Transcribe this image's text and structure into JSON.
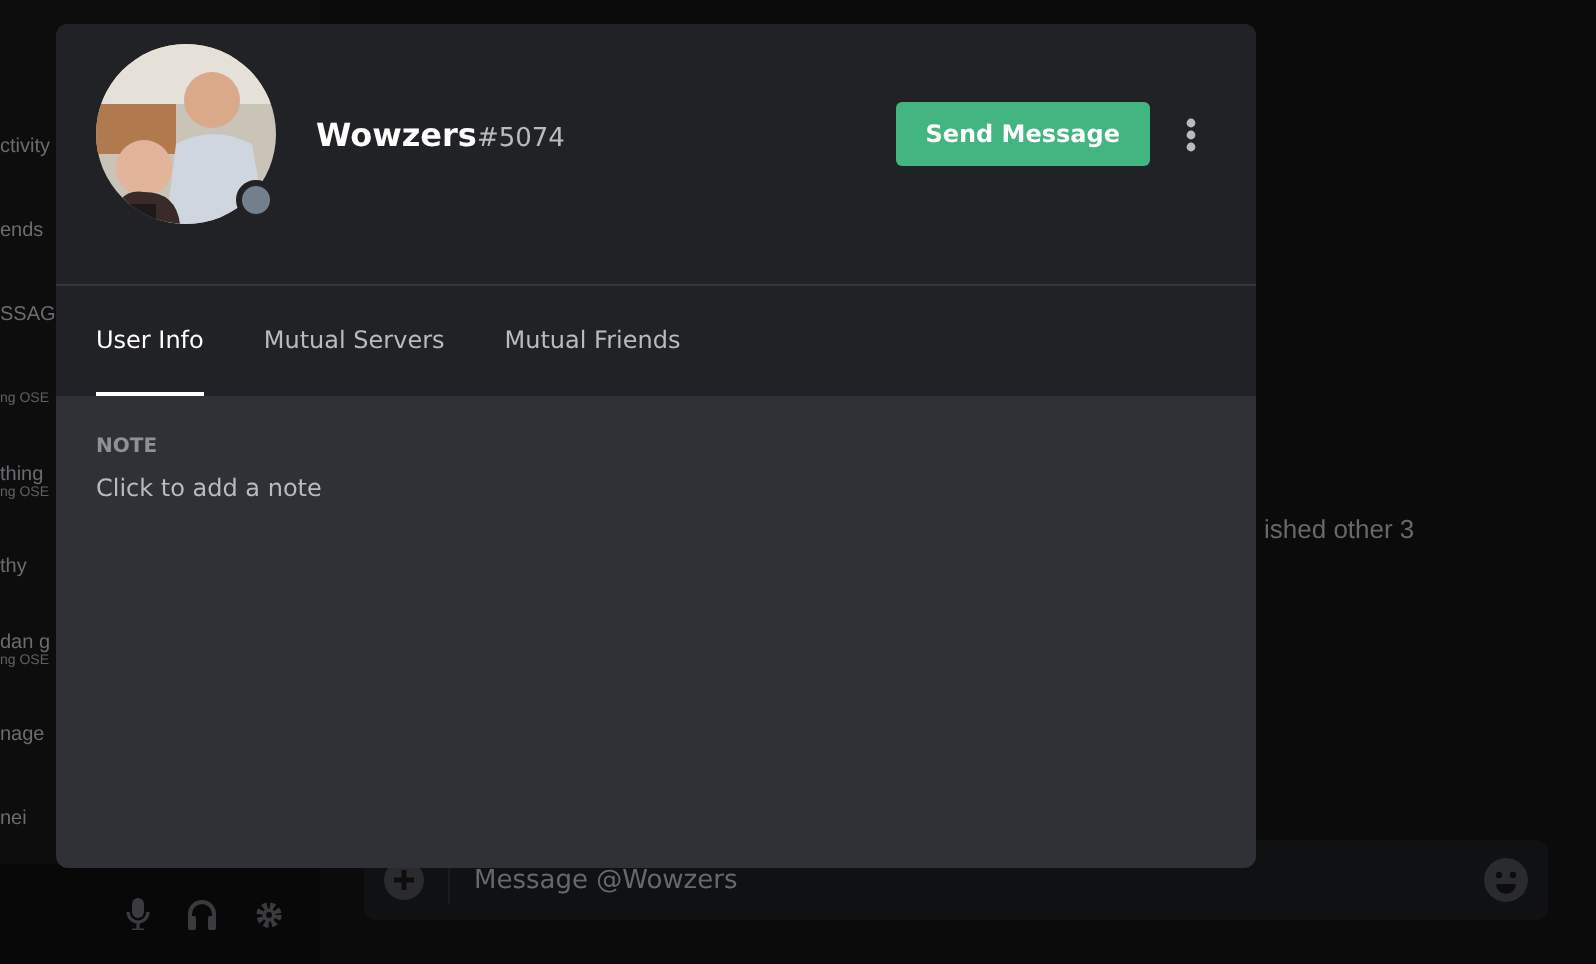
{
  "background": {
    "sidebar_items": [
      {
        "label": "ctivity"
      },
      {
        "label": "ends"
      },
      {
        "label": "SSAG"
      },
      {
        "sub": "ng OSE"
      },
      {
        "label": "thing",
        "sub": "ng OSE"
      },
      {
        "label": "thy"
      },
      {
        "label": "dan g",
        "sub": "ng OSE"
      },
      {
        "label": "nage"
      },
      {
        "label": "nei"
      }
    ],
    "chat_text": "ished other 3",
    "message_placeholder": "Message @Wowzers"
  },
  "profile": {
    "username": "Wowzers",
    "discriminator": "#5074",
    "send_button": "Send Message",
    "tabs": [
      {
        "label": "User Info",
        "selected": true
      },
      {
        "label": "Mutual Servers",
        "selected": false
      },
      {
        "label": "Mutual Friends",
        "selected": false
      }
    ],
    "note_heading": "NOTE",
    "note_placeholder": "Click to add a note"
  }
}
